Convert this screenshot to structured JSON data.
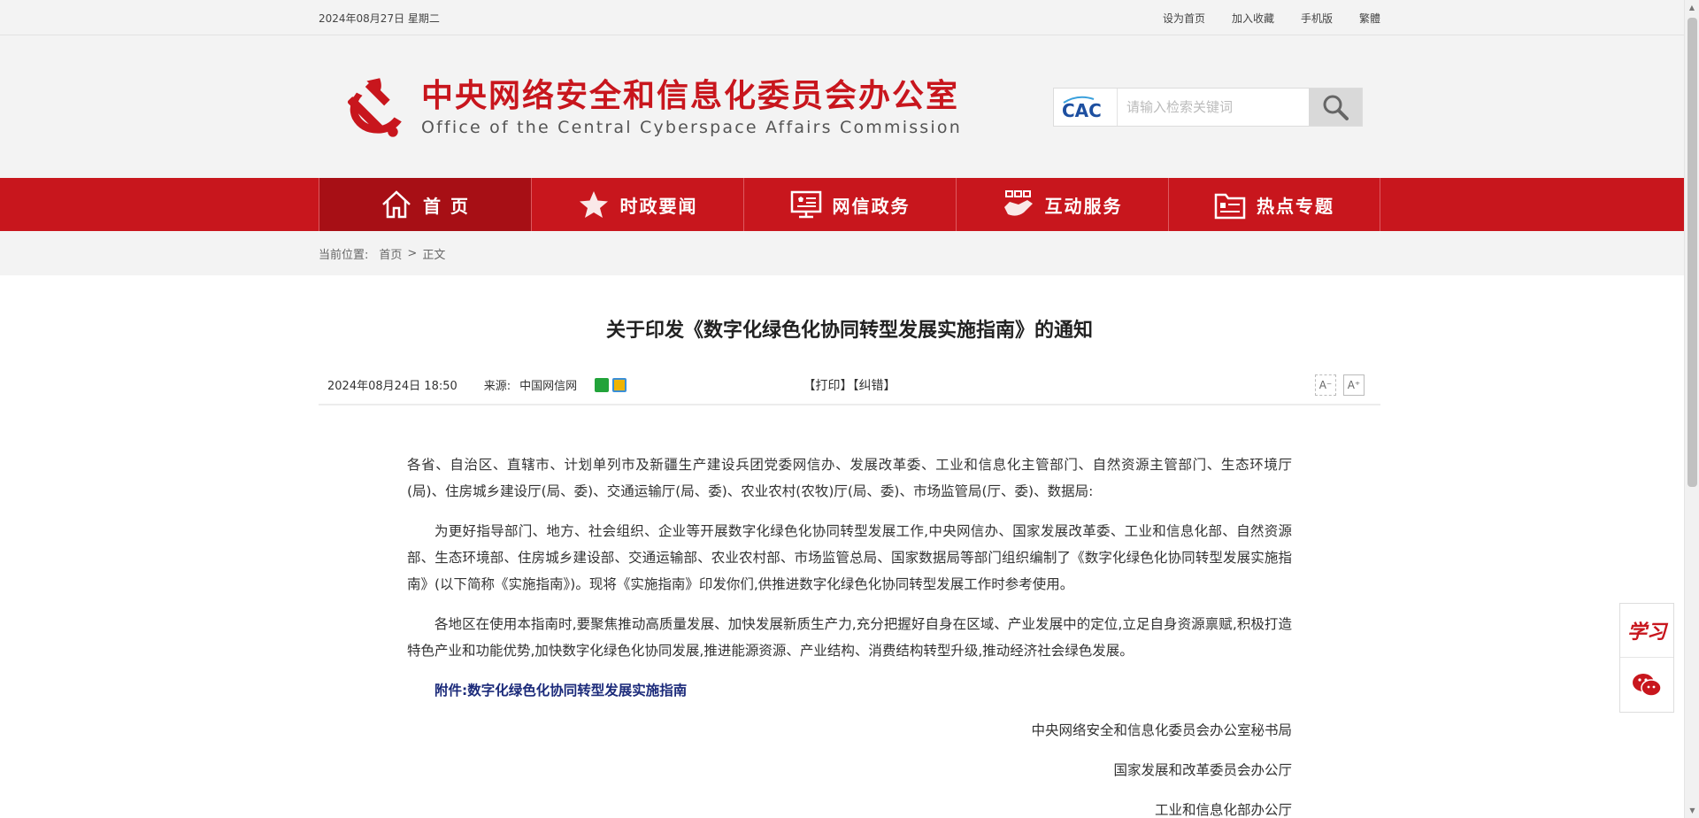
{
  "topbar": {
    "date": "2024年08月27日 星期二",
    "links": [
      "设为首页",
      "加入收藏",
      "手机版",
      "繁體"
    ]
  },
  "header": {
    "title_cn": "中央网络安全和信息化委员会办公室",
    "title_en": "Office of the Central Cyberspace Affairs Commission",
    "cac_logo_text": "CAC",
    "search_placeholder": "请输入检索关键词"
  },
  "nav": {
    "items": [
      {
        "label": "首 页",
        "icon": "home-icon"
      },
      {
        "label": "时政要闻",
        "icon": "star-icon"
      },
      {
        "label": "网信政务",
        "icon": "monitor-icon"
      },
      {
        "label": "互动服务",
        "icon": "handshake-icon"
      },
      {
        "label": "热点专题",
        "icon": "folder-icon"
      }
    ],
    "active_index": 0,
    "color": "#c8161d"
  },
  "breadcrumb": {
    "label": "当前位置:",
    "home": "首页",
    "sep": ">",
    "current": "正文"
  },
  "article": {
    "title": "关于印发《数字化绿色化协同转型发展实施指南》的通知",
    "datetime": "2024年08月24日 18:50",
    "source_label": "来源:",
    "source": "中国网信网",
    "print": "【打印】",
    "correct": "【纠错】",
    "font_small": "A⁻",
    "font_large": "A⁺",
    "p1": "各省、自治区、直辖市、计划单列市及新疆生产建设兵团党委网信办、发展改革委、工业和信息化主管部门、自然资源主管部门、生态环境厅(局)、住房城乡建设厅(局、委)、交通运输厅(局、委)、农业农村(农牧)厅(局、委)、市场监管局(厅、委)、数据局:",
    "p2": "为更好指导部门、地方、社会组织、企业等开展数字化绿色化协同转型发展工作,中央网信办、国家发展改革委、工业和信息化部、自然资源部、生态环境部、住房城乡建设部、交通运输部、农业农村部、市场监管总局、国家数据局等部门组织编制了《数字化绿色化协同转型发展实施指南》(以下简称《实施指南》)。现将《实施指南》印发你们,供推进数字化绿色化协同转型发展工作时参考使用。",
    "p3": "各地区在使用本指南时,要聚焦推动高质量发展、加快发展新质生产力,充分把握好自身在区域、产业发展中的定位,立足自身资源禀赋,积极打造特色产业和功能优势,加快数字化绿色化协同发展,推进能源资源、产业结构、消费结构转型升级,推动经济社会绿色发展。",
    "attachment": "附件:数字化绿色化协同转型发展实施指南",
    "signers": [
      "中央网络安全和信息化委员会办公室秘书局",
      "国家发展和改革委员会办公厅",
      "工业和信息化部办公厅"
    ]
  },
  "side": {
    "xuexi": "学习",
    "wechat_icon": "wechat-icon"
  }
}
